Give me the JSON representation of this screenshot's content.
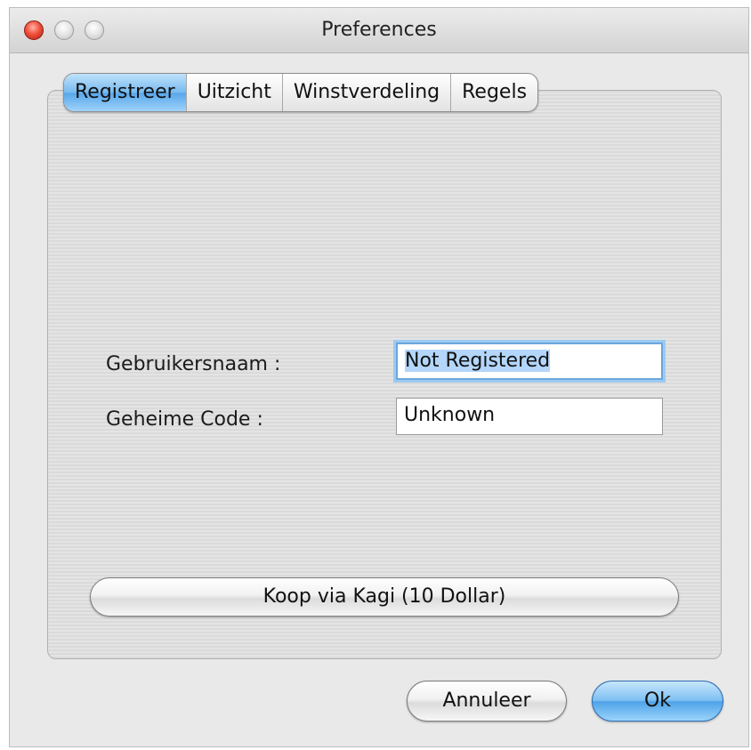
{
  "window": {
    "title": "Preferences"
  },
  "tabs": [
    {
      "label": "Registreer",
      "active": true
    },
    {
      "label": "Uitzicht",
      "active": false
    },
    {
      "label": "Winstverdeling",
      "active": false
    },
    {
      "label": "Regels",
      "active": false
    }
  ],
  "form": {
    "username_label": "Gebruikersnaam :",
    "username_value": "Not Registered",
    "code_label": "Geheime Code :",
    "code_value": "Unknown"
  },
  "buttons": {
    "buy_label": "Koop via Kagi (10 Dollar)",
    "cancel_label": "Annuleer",
    "ok_label": "Ok"
  },
  "colors": {
    "accent": "#58a7ea",
    "close": "#f0503c"
  }
}
